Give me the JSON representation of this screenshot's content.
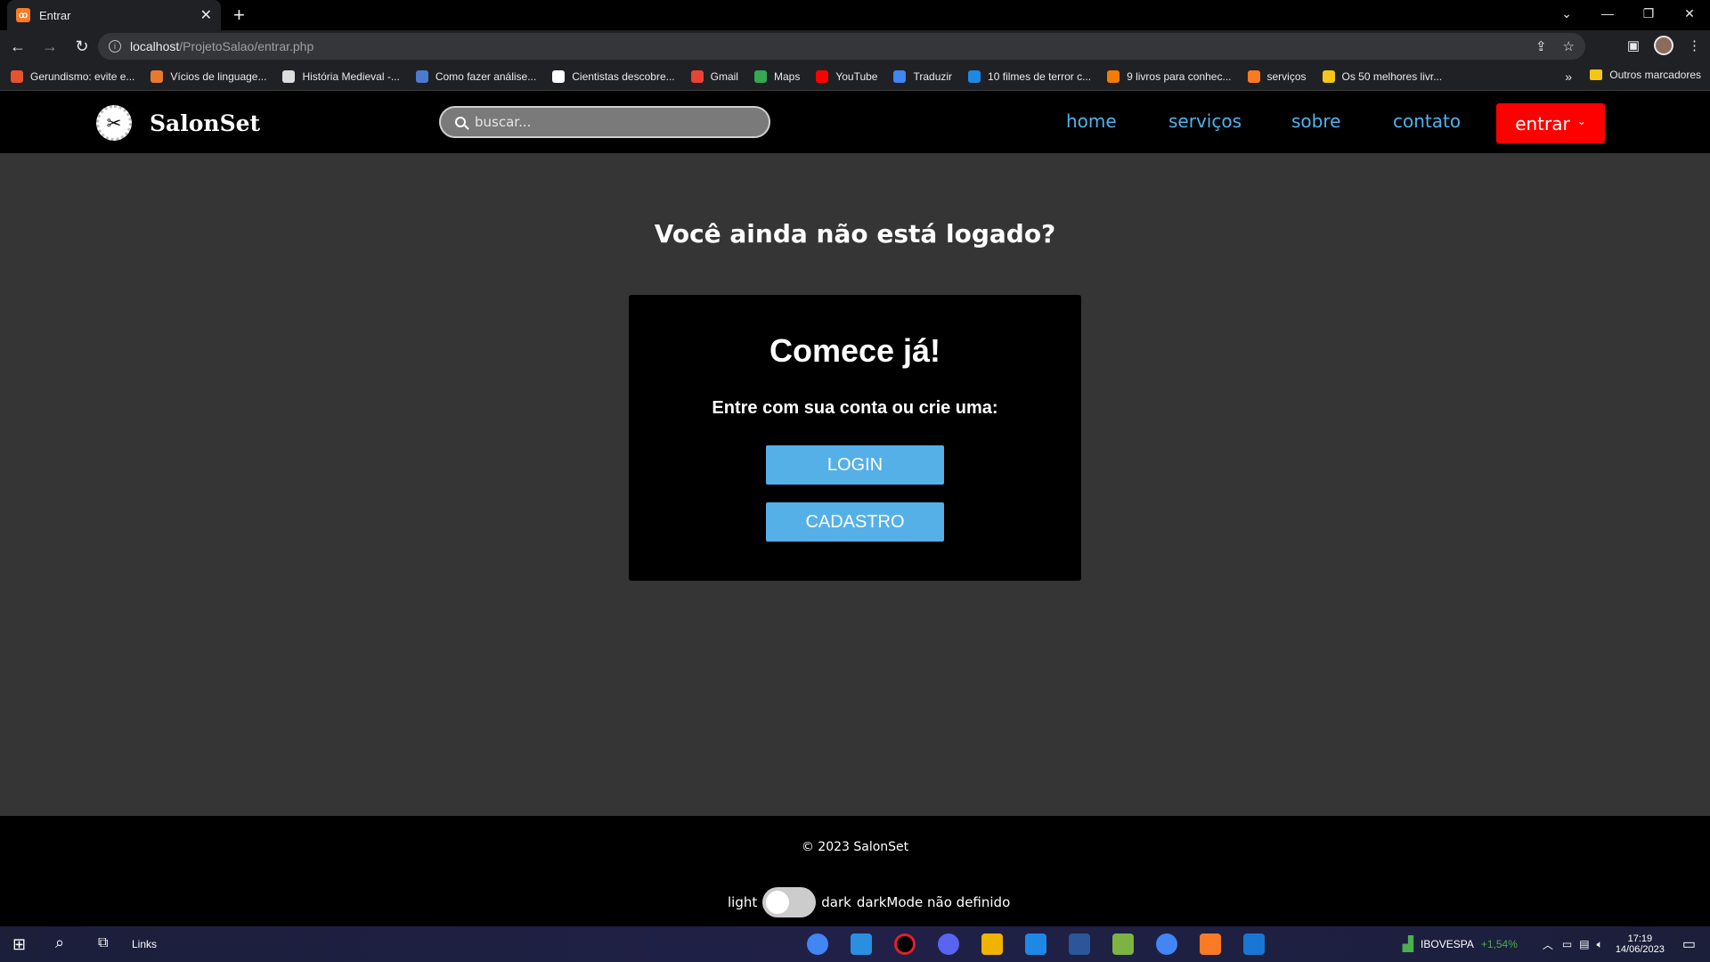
{
  "browser": {
    "tab_title": "Entrar",
    "tab_favicon": "xampp-icon",
    "url_host": "localhost",
    "url_path": "/ProjetoSalao/entrar.php",
    "bookmarks": [
      {
        "label": "Gerundismo: evite e...",
        "color": "#e8532f"
      },
      {
        "label": "Vícios de linguage...",
        "color": "#e87a2f"
      },
      {
        "label": "História Medieval -...",
        "color": "#dddddd"
      },
      {
        "label": "Como fazer análise...",
        "color": "#4a7bd0"
      },
      {
        "label": "Cientistas descobre...",
        "color": "#ffffff"
      },
      {
        "label": "Gmail",
        "color": "#ea4335"
      },
      {
        "label": "Maps",
        "color": "#34a853"
      },
      {
        "label": "YouTube",
        "color": "#ff0000"
      },
      {
        "label": "Traduzir",
        "color": "#4285f4"
      },
      {
        "label": "10 filmes de terror c...",
        "color": "#1e88e5"
      },
      {
        "label": "9 livros para conhec...",
        "color": "#f57c00"
      },
      {
        "label": "serviços",
        "color": "#fb7a24"
      },
      {
        "label": "Os 50 melhores livr...",
        "color": "#f5c518"
      }
    ],
    "other_bookmarks": "Outros marcadores"
  },
  "header": {
    "logo_text": "SalonSet",
    "search_placeholder": "buscar...",
    "nav": {
      "home": "home",
      "services": "serviços",
      "about": "sobre",
      "contact": "contato"
    },
    "enter_label": "entrar",
    "nav_color": "#4fb3ee",
    "enter_color": "#ff0000"
  },
  "main": {
    "question": "Você ainda não está logado?",
    "card_title": "Comece já!",
    "card_subtitle": "Entre com sua conta ou crie uma:",
    "login_label": "LOGIN",
    "signup_label": "CADASTRO",
    "button_color": "#55b0e8"
  },
  "footer": {
    "copyright": "© 2023 SalonSet",
    "light_label": "light",
    "dark_label": "dark",
    "mode_status": "darkMode não definido"
  },
  "taskbar": {
    "links_label": "Links",
    "stock_name": "IBOVESPA",
    "stock_change": "+1,54%",
    "time": "17:19",
    "date": "14/06/2023"
  }
}
